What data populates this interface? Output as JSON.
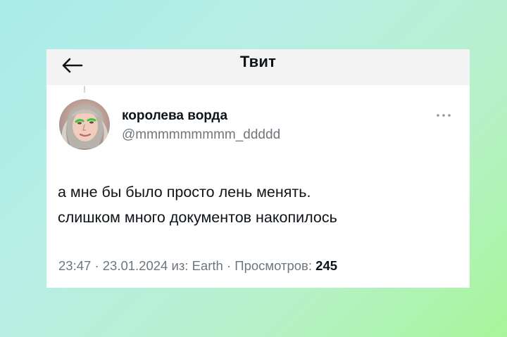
{
  "header": {
    "title": "Твит",
    "back_icon": "arrow-left-icon"
  },
  "tweet": {
    "author_name": "королева ворда",
    "author_handle": "@mmmmmmmmm_ddddd",
    "more_icon": "more-dots-icon",
    "text_lines": [
      "а мне бы было просто лень менять.",
      "слишком много документов накопилось"
    ],
    "time": "23:47",
    "date": "23.01.2024",
    "source": "из: Earth",
    "views_label": "Просмотров:",
    "views_count": "245"
  },
  "colors": {
    "text_primary": "#0f1419",
    "text_secondary": "#6e767d",
    "header_bg": "#f3f3f3"
  }
}
